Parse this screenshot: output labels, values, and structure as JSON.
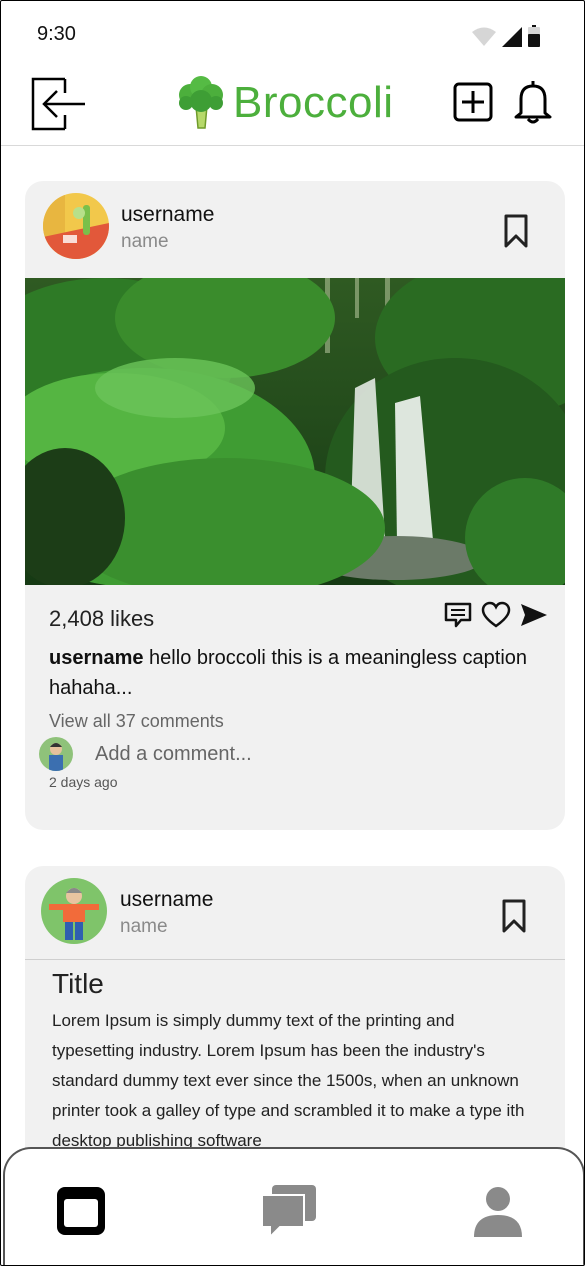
{
  "status_bar": {
    "time": "9:30"
  },
  "header": {
    "brand": "Broccoli"
  },
  "posts": [
    {
      "username": "username",
      "name": "name",
      "likes": "2,408 likes",
      "caption_user": "username",
      "caption_text": " hello broccoli this is a meaningless caption hahaha...",
      "view_comments": "View all 37 comments",
      "comment_placeholder": "Add a comment...",
      "time_ago": "2 days ago"
    },
    {
      "username": "username",
      "name": "name",
      "title": "Title",
      "body": "Lorem Ipsum is simply dummy text of the printing and typesetting industry. Lorem Ipsum has been the industry's standard dummy text ever since the 1500s, when an unknown printer took a galley of type and scrambled it to make a type ith desktop publishing software"
    }
  ],
  "bottom_nav": [
    "feed-icon",
    "chat-icon",
    "profile-icon"
  ],
  "colors": {
    "brand_green": "#4caf3c",
    "card_bg": "#f1f1f1"
  }
}
